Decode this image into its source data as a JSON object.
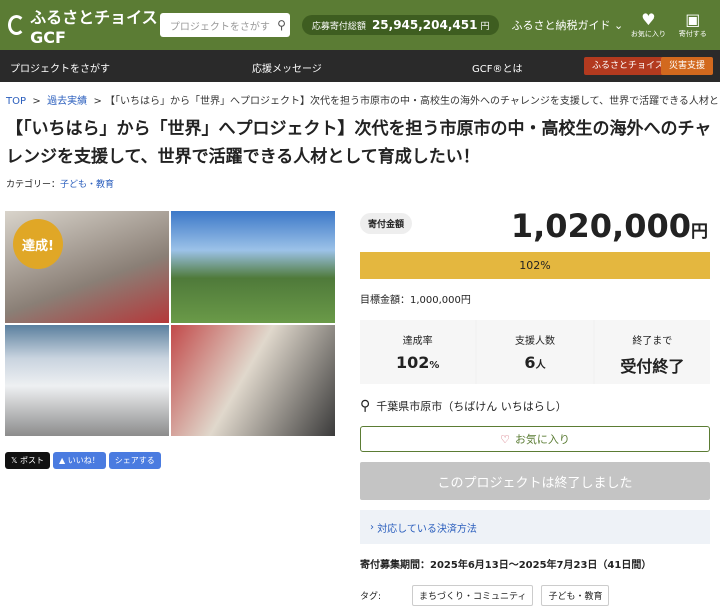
{
  "header": {
    "logo": "ふるさとチョイスGCF",
    "search_placeholder": "プロジェクトをさがす",
    "total_label": "応募寄付総額",
    "total_value": "25,945,204,451",
    "total_unit": "円",
    "guide": "ふるさと納税ガイド",
    "fav": "お気に入り",
    "donate": "寄付する"
  },
  "nav": {
    "find": "プロジェクトをさがす",
    "support": "応援メッセージ",
    "about": "GCF®とは",
    "choice": "ふるさとチョイス",
    "disaster": "災害支援"
  },
  "breadcrumb": {
    "top": "TOP",
    "past": "過去実績",
    "current": "【「いちはら」から「世界」へプロジェクト】次代を担う市原市の中・高校生の海外へのチャレンジを支援して、世界で活躍できる人材として育成したい！"
  },
  "title": "【「いちはら」から「世界」へプロジェクト】次代を担う市原市の中・高校生の海外へのチャレンジを支援して、世界で活躍できる人材として育成したい！",
  "category": {
    "label": "カテゴリー：",
    "value": "子ども・教育"
  },
  "badge": "達成!",
  "share": {
    "post": "ポスト",
    "like": "いいね！",
    "share": "シェアする"
  },
  "donation": {
    "label": "寄付金額",
    "amount": "1,020,000",
    "unit": "円",
    "progress_text": "102%",
    "progress": 1.02,
    "goal": "目標金額：1,000,000円"
  },
  "stats": {
    "rate_label": "達成率",
    "rate": "102",
    "rate_unit": "%",
    "supporters_label": "支援人数",
    "supporters": "6",
    "supporters_unit": "人",
    "end_label": "終了まで",
    "end": "受付終了"
  },
  "location": "千葉県市原市（ちばけん いちはらし）",
  "favorite": "お気に入り",
  "ended": "このプロジェクトは終了しました",
  "payment": "対応している決済方法",
  "period": "寄付募集期間：2025年6月13日〜2025年7月23日（41日間）",
  "tags": {
    "label": "タグ:",
    "t1": "まちづくり・コミュニティ",
    "t2": "子ども・教育"
  }
}
